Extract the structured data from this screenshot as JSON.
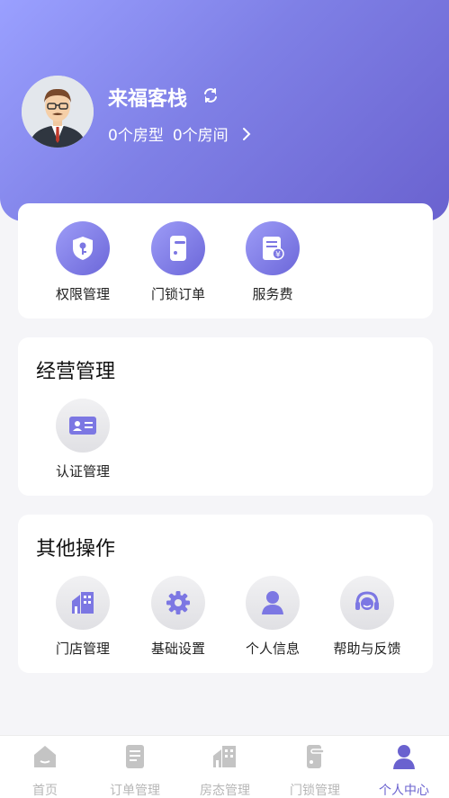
{
  "profile": {
    "shop_name": "来福客栈",
    "room_types": "0个房型",
    "rooms": "0个房间"
  },
  "quick_actions": [
    {
      "label": "权限管理",
      "icon": "shield-key-icon"
    },
    {
      "label": "门锁订单",
      "icon": "door-lock-icon"
    },
    {
      "label": "服务费",
      "icon": "fee-document-icon"
    }
  ],
  "business": {
    "title": "经营管理",
    "items": [
      {
        "label": "认证管理",
        "icon": "id-card-icon"
      }
    ]
  },
  "other": {
    "title": "其他操作",
    "items": [
      {
        "label": "门店管理",
        "icon": "store-icon"
      },
      {
        "label": "基础设置",
        "icon": "gear-icon"
      },
      {
        "label": "个人信息",
        "icon": "person-icon"
      },
      {
        "label": "帮助与反馈",
        "icon": "headset-icon"
      }
    ]
  },
  "tabs": [
    {
      "label": "首页",
      "icon": "home-icon"
    },
    {
      "label": "订单管理",
      "icon": "order-icon"
    },
    {
      "label": "房态管理",
      "icon": "room-status-icon"
    },
    {
      "label": "门锁管理",
      "icon": "lock-icon"
    },
    {
      "label": "个人中心",
      "icon": "user-center-icon"
    }
  ],
  "colors": {
    "accent": "#6a62cf",
    "header_start": "#9aa0ff",
    "header_end": "#6a62cf",
    "tab_inactive": "#b7b7b7"
  }
}
